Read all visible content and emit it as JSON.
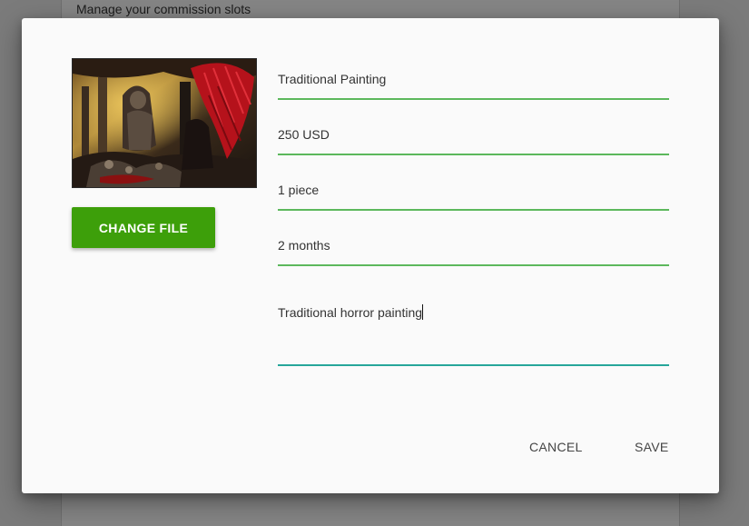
{
  "background": {
    "card_title": "Manage your commission slots"
  },
  "dialog": {
    "image_alt": "Dark horror painting with a red winged figure",
    "change_file_label": "CHANGE FILE",
    "fields": {
      "title": "Traditional Painting",
      "price": "250 USD",
      "quantity": "1 piece",
      "duration": "2 months",
      "description": "Traditional horror painting"
    },
    "cancel_label": "CANCEL",
    "save_label": "SAVE"
  },
  "colors": {
    "accent_green": "#3d9f0a",
    "field_underline": "#5cb85c",
    "focused_underline": "#26a69a"
  }
}
